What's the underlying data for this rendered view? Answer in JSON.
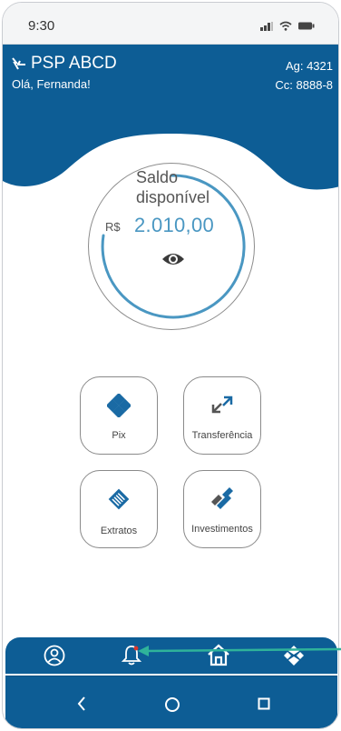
{
  "status_bar": {
    "time": "9:30"
  },
  "header": {
    "brand": "PSP ABCD",
    "greeting": "Olá, Fernanda!",
    "agency": "Ag: 4321",
    "account": "Cc: 8888-8"
  },
  "balance": {
    "title": "Saldo disponível",
    "currency": "R$",
    "amount": "2.010,00"
  },
  "actions": [
    {
      "label": "Pix",
      "icon": "pix-icon"
    },
    {
      "label": "Transferência",
      "icon": "transfer-arrows-icon"
    },
    {
      "label": "Extratos",
      "icon": "statement-icon"
    },
    {
      "label": "Investimentos",
      "icon": "investments-icon"
    }
  ],
  "tabbar": {
    "items": [
      "profile-icon",
      "bell-icon",
      "home-icon",
      "pix-icon"
    ]
  },
  "colors": {
    "primary": "#0d5d95",
    "accent": "#4a97c2",
    "annotation": "#2fb39a"
  }
}
